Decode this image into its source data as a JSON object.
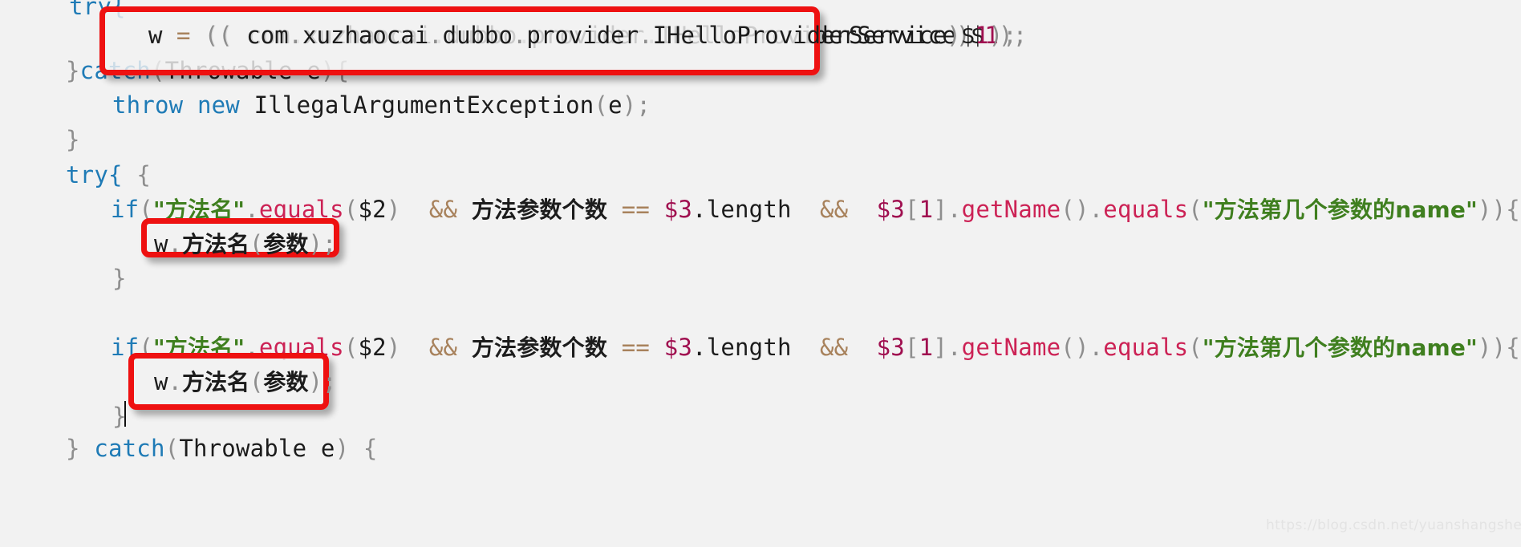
{
  "editor": {
    "background_color": "#f2f2f2",
    "font_size_px": 29,
    "caret_visible": true
  },
  "colors": {
    "annotation_red": "#ee1111",
    "keyword_blue": "#1f7bb6",
    "string_green": "#3f7f1f",
    "method_pink": "#cc2255",
    "number_magenta": "#a01050",
    "operator_tan": "#a8825c",
    "punct_gray": "#8e8e8e",
    "text_black": "#1c1c1c",
    "watermark_gray": "#e3e3e3"
  },
  "code": {
    "lines": [
      {
        "id": "line-try-1",
        "text": "try{",
        "tokens": [
          {
            "t": "try",
            "c": "tok-kw"
          },
          {
            "t": "{",
            "c": "tok-punct"
          }
        ]
      },
      {
        "id": "line-cast-assign",
        "text": "    w = (( com.xuzhaocai.dubbo.provider.IHelloProviderService)$1);",
        "tokens": [
          {
            "t": "    w ",
            "c": "tok-plain"
          },
          {
            "t": "=",
            "c": "tok-op"
          },
          {
            "t": " ",
            "c": "tok-plain"
          },
          {
            "t": "((",
            "c": "tok-punct"
          },
          {
            "t": " com",
            "c": "tok-plain"
          },
          {
            "t": ".",
            "c": "tok-punct"
          },
          {
            "t": "xuzhaocai",
            "c": "tok-plain"
          },
          {
            "t": ".",
            "c": "tok-punct"
          },
          {
            "t": "dubbo",
            "c": "tok-plain"
          },
          {
            "t": ".",
            "c": "tok-punct"
          },
          {
            "t": "provider",
            "c": "tok-plain"
          },
          {
            "t": ".",
            "c": "tok-punct"
          },
          {
            "t": "IHelloProviderService",
            "c": "tok-plain"
          },
          {
            "t": ")",
            "c": "tok-punct"
          },
          {
            "t": "$",
            "c": "tok-plain"
          },
          {
            "t": "1",
            "c": "tok-num"
          },
          {
            "t": ");",
            "c": "tok-punct"
          }
        ]
      },
      {
        "id": "line-catch-1",
        "text": "}catch(Throwable e){",
        "tokens": [
          {
            "t": "}",
            "c": "tok-punct"
          },
          {
            "t": "catch",
            "c": "tok-kw"
          },
          {
            "t": "(",
            "c": "tok-punct"
          },
          {
            "t": "Throwable e",
            "c": "tok-plain"
          },
          {
            "t": "){",
            "c": "tok-punct"
          }
        ]
      },
      {
        "id": "line-throw",
        "text": "    throw new IllegalArgumentException(e);",
        "tokens": [
          {
            "t": "    ",
            "c": "tok-plain"
          },
          {
            "t": "throw new",
            "c": "tok-kw"
          },
          {
            "t": " IllegalArgumentException",
            "c": "tok-plain"
          },
          {
            "t": "(",
            "c": "tok-punct"
          },
          {
            "t": "e",
            "c": "tok-plain"
          },
          {
            "t": ");",
            "c": "tok-punct"
          }
        ]
      },
      {
        "id": "line-close-1",
        "text": "}",
        "tokens": [
          {
            "t": "}",
            "c": "tok-punct"
          }
        ]
      },
      {
        "id": "line-try-2",
        "text": "try{",
        "tokens": [
          {
            "t": "try",
            "c": "tok-kw"
          },
          {
            "t": "{",
            "c": "tok-punct"
          }
        ]
      },
      {
        "id": "line-if-1",
        "text": "    if(\"方法名\".equals($2)  && 方法参数个数 == $3.length  &&  $3[1].getName().equals(\"方法第几个参数的name\")){"
      },
      {
        "id": "line-call-1",
        "text": "        w.方法名(参数);"
      },
      {
        "id": "line-close-2",
        "text": "    }",
        "tokens": [
          {
            "t": "    }",
            "c": "tok-punct"
          }
        ]
      },
      {
        "id": "line-if-2",
        "text": "    if(\"方法名\".equals($2)  && 方法参数个数 == $3.length  &&  $3[1].getName().equals(\"方法第几个参数的name\")){"
      },
      {
        "id": "line-call-2",
        "text": "        w.方法名(参数);"
      },
      {
        "id": "line-close-3",
        "text": "    }",
        "tokens": [
          {
            "t": "    }",
            "c": "tok-punct"
          }
        ]
      },
      {
        "id": "line-catch-2",
        "text": "} catch(Throwable e) {",
        "tokens": [
          {
            "t": "} ",
            "c": "tok-punct"
          },
          {
            "t": "catch",
            "c": "tok-kw"
          },
          {
            "t": "(",
            "c": "tok-punct"
          },
          {
            "t": "Throwable e",
            "c": "tok-plain"
          },
          {
            "t": ") {",
            "c": "tok-punct"
          }
        ]
      }
    ]
  },
  "line_text": {
    "try1": "try{",
    "cast_indent": "  w ",
    "cast_eq": "=",
    "cast_openparens": " ((",
    "cast_pkg_com": " com",
    "dot": ".",
    "cast_pkg_xuzhaocai": "xuzhaocai",
    "cast_pkg_dubbo": "dubbo",
    "cast_pkg_provider": "provider",
    "cast_type": "IHelloProviderService",
    "cast_closeparen": ")",
    "cast_dollar": "$",
    "cast_one": "1",
    "cast_tail": ");",
    "catch1_brace": "}",
    "catch1_kw": "catch",
    "catch1_open": "(",
    "catch1_arg": "Throwable e",
    "catch1_tail": "){",
    "throw_kw": "throw new",
    "throw_type": " IllegalArgumentException",
    "throw_open": "(",
    "throw_arg": "e",
    "throw_tail": ");",
    "close_brace": "}",
    "try2": "try{",
    "if_kw": "if",
    "if_open": "(",
    "if_str1": "\"方法名\"",
    "if_dot": ".",
    "if_equals1": "equals",
    "if_open2": "(",
    "if_dollar2": "$2",
    "if_close2": ")",
    "if_and1": "&&",
    "if_cjk_count": "方法参数个数",
    "if_eqeq": "==",
    "if_dollar3": "$3",
    "if_length": ".length",
    "if_and2": "&&",
    "if_dollar3b": "$3",
    "if_bracket_open": "[",
    "if_index": "1",
    "if_bracket_close": "]",
    "if_dot2": ".",
    "if_getname": "getName",
    "if_parens": "()",
    "if_dot3": ".",
    "if_equals2": "equals",
    "if_open3": "(",
    "if_str2": "\"方法第几个参数的name\"",
    "if_tail": ")){",
    "call_w": "w",
    "call_dot": ".",
    "call_cjk_method": "方法名",
    "call_open": "(",
    "call_cjk_args": "参数",
    "call_close": ")",
    "call_semi": ";",
    "inner_close": "}",
    "outer_close": "}",
    "catch2_brace": "} ",
    "catch2_kw": "catch",
    "catch2_open": "(",
    "catch2_arg": "Throwable e",
    "catch2_tail": ") {"
  },
  "annotations": {
    "boxes": [
      {
        "id": "annotation-box-cast",
        "label": "highlight-cast-assignment",
        "target_line": "w = (( com.xuzhaocai.dubbo.provider.IHelloProviderService)$1);"
      },
      {
        "id": "annotation-box-call-1",
        "label": "highlight-method-invocation-1",
        "target_line": "w.方法名(参数);"
      },
      {
        "id": "annotation-box-call-2",
        "label": "highlight-method-invocation-2",
        "target_line": "w.方法名(参数);"
      }
    ]
  },
  "watermark": {
    "text": "https://blog.csdn.net/yuanshangshenghuo"
  }
}
